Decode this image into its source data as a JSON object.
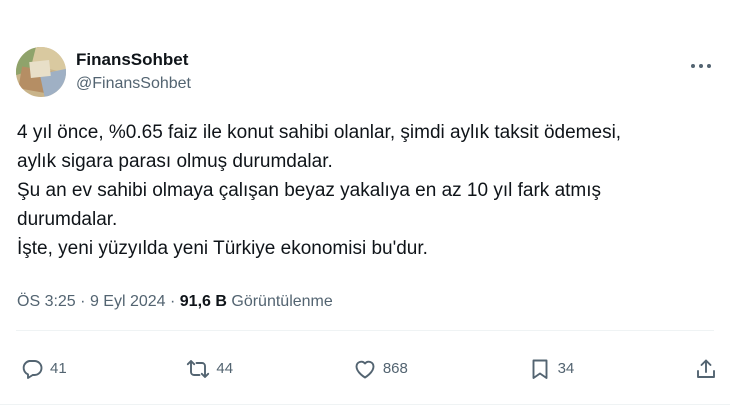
{
  "author": {
    "display_name": "FinansSohbet",
    "handle": "@FinansSohbet"
  },
  "tweet": {
    "lines": [
      "4 yıl önce, %0.65 faiz ile konut sahibi olanlar, şimdi aylık taksit ödemesi,",
      "aylık sigara parası olmuş durumdalar.",
      "Şu an ev sahibi olmaya çalışan beyaz yakalıya en az 10 yıl fark atmış",
      "durumdalar.",
      "İşte, yeni yüzyılda yeni Türkiye ekonomisi bu'dur."
    ]
  },
  "meta": {
    "time": "ÖS 3:25",
    "separator": "·",
    "date": "9 Eyl 2024",
    "views_count": "91,6 B",
    "views_label": "Görüntülenme"
  },
  "actions": {
    "replies": "41",
    "reposts": "44",
    "likes": "868",
    "bookmarks": "34"
  },
  "icons": [
    "more-icon",
    "reply-icon",
    "repost-icon",
    "like-icon",
    "bookmark-icon",
    "share-icon"
  ],
  "colors": {
    "text": "#0f1419",
    "secondary": "#536471",
    "divider": "#eff3f4"
  }
}
